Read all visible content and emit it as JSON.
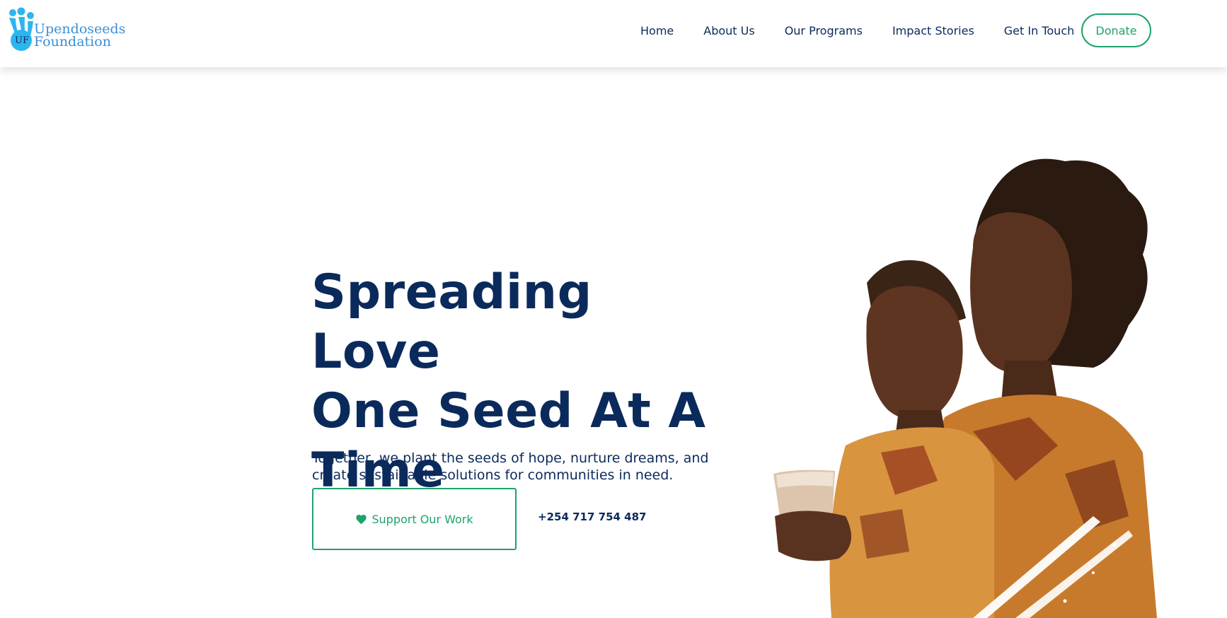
{
  "brand": {
    "monogram": "UF",
    "name_line1": "Upendoseeds",
    "name_line2": "Foundation"
  },
  "nav": {
    "items": [
      "Home",
      "About Us",
      "Our Programs",
      "Impact Stories",
      "Get In Touch"
    ],
    "donate_label": "Donate"
  },
  "hero": {
    "title_line1": "Spreading Love",
    "title_line2": "One Seed At A",
    "title_line3": "Time",
    "subtitle_line1": "Together, we plant the seeds of hope, nurture dreams, and",
    "subtitle_line2": "create sustainable solutions for communities in need.",
    "cta_label": "Support Our Work",
    "cta_icon": "heart-icon",
    "phone": "+254 717 754 487"
  },
  "colors": {
    "navy": "#0b2a5c",
    "green": "#1fa36b",
    "logo_blue": "#3a8fd9",
    "logo_cyan": "#2cb6ef"
  }
}
